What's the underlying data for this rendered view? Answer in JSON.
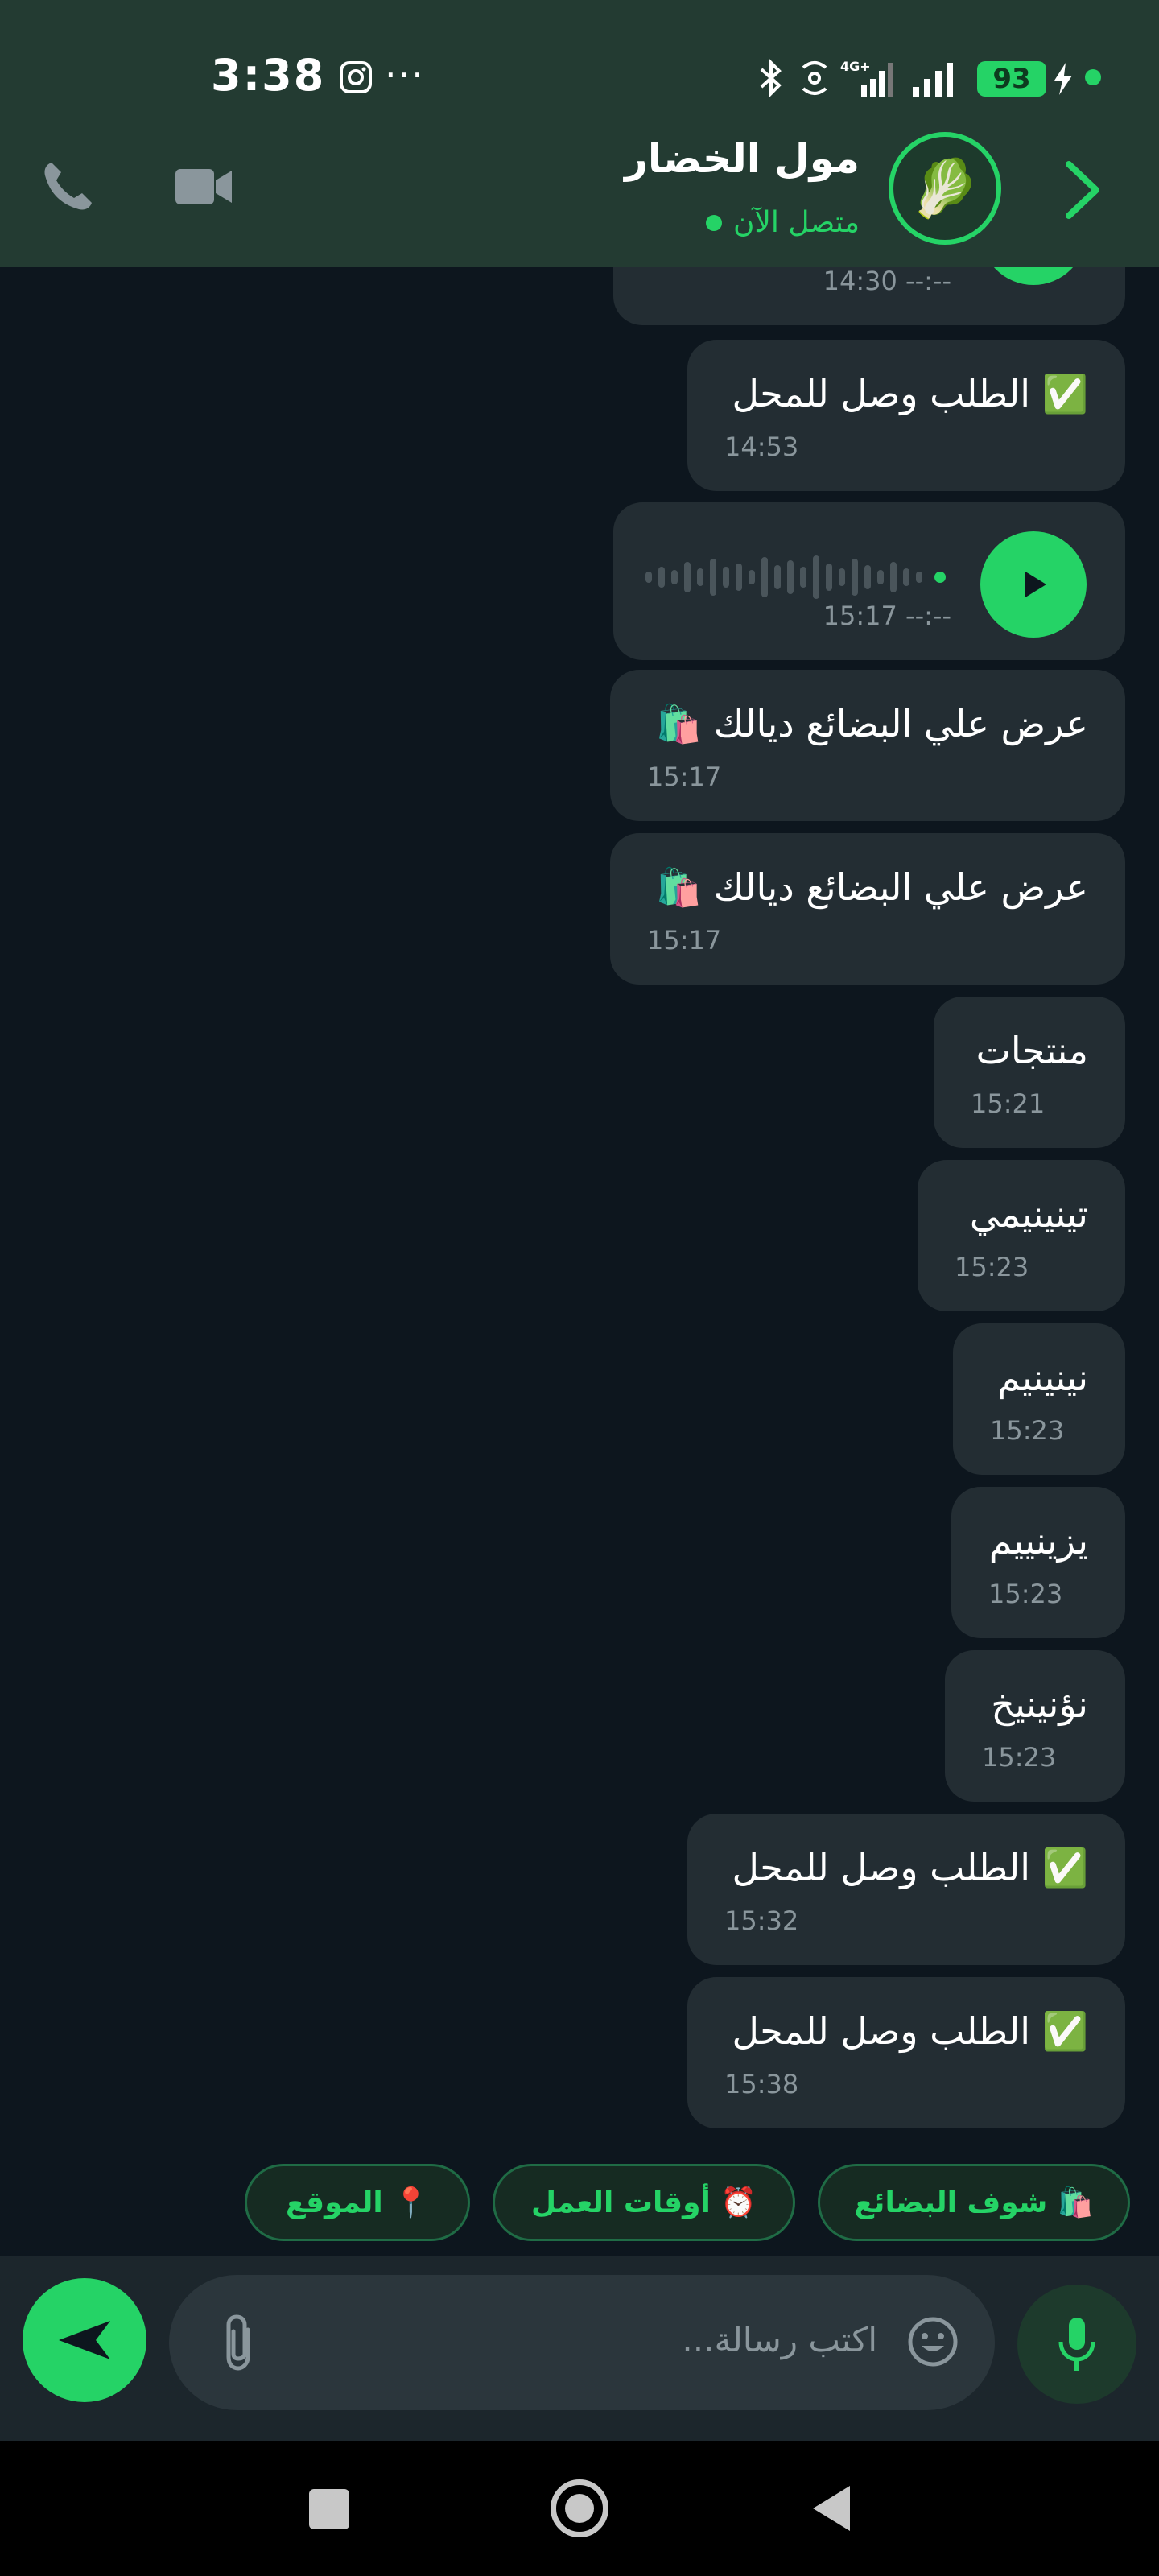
{
  "status_bar": {
    "time": "3:38",
    "battery": "93",
    "more": "···"
  },
  "header": {
    "contact_name": "مول الخضار",
    "presence": "متصل الآن",
    "avatar_emoji": "🥬",
    "accent_color": "#25d366"
  },
  "messages": [
    {
      "text": "",
      "time": "14:30  --:--",
      "kind": "partial-audio"
    },
    {
      "text": "✅ الطلب وصل للمحل",
      "time": "14:53",
      "kind": "text"
    },
    {
      "text": "",
      "time": "15:17  --:--",
      "kind": "audio"
    },
    {
      "text": "عرض علي البضائع ديالك 🛍️",
      "time": "15:17",
      "kind": "text"
    },
    {
      "text": "عرض علي البضائع ديالك 🛍️",
      "time": "15:17",
      "kind": "text"
    },
    {
      "text": "منتجات",
      "time": "15:21",
      "kind": "text"
    },
    {
      "text": "تينينيمي",
      "time": "15:23",
      "kind": "text"
    },
    {
      "text": "نينينيم",
      "time": "15:23",
      "kind": "text"
    },
    {
      "text": "يزينييم",
      "time": "15:23",
      "kind": "text"
    },
    {
      "text": "نؤنينيخ",
      "time": "15:23",
      "kind": "text"
    },
    {
      "text": "✅ الطلب وصل للمحل",
      "time": "15:32",
      "kind": "text"
    },
    {
      "text": "✅ الطلب وصل للمحل",
      "time": "15:38",
      "kind": "text"
    }
  ],
  "quick_replies": [
    {
      "label": "🛍️ شوف البضائع"
    },
    {
      "label": "⏰ أوقات العمل"
    },
    {
      "label": "📍 الموقع"
    }
  ],
  "composer": {
    "placeholder": "اكتب رسالة..."
  }
}
